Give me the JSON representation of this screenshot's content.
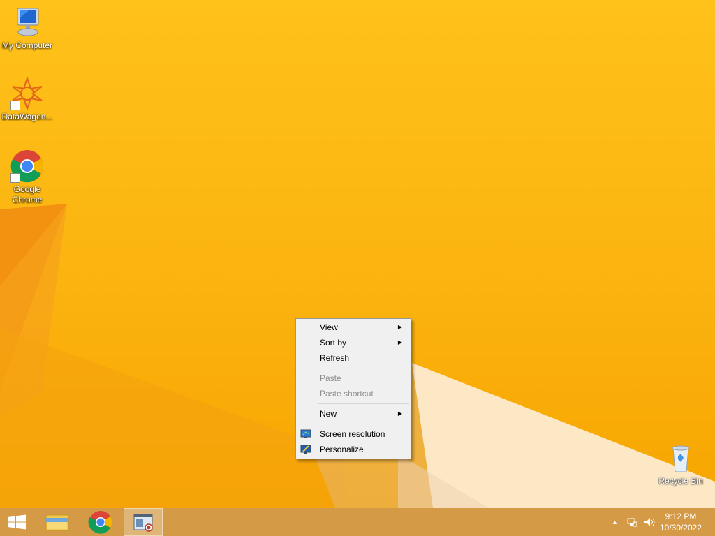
{
  "desktop": {
    "icons": [
      {
        "label": "My Computer"
      },
      {
        "label": "DataWagon..."
      },
      {
        "label": "Google Chrome"
      },
      {
        "label": "Recycle Bin"
      }
    ]
  },
  "context_menu": {
    "items": [
      {
        "label": "View",
        "has_submenu": true,
        "enabled": true
      },
      {
        "label": "Sort by",
        "has_submenu": true,
        "enabled": true
      },
      {
        "label": "Refresh",
        "has_submenu": false,
        "enabled": true
      },
      {
        "label": "Paste",
        "has_submenu": false,
        "enabled": false
      },
      {
        "label": "Paste shortcut",
        "has_submenu": false,
        "enabled": false
      },
      {
        "label": "New",
        "has_submenu": true,
        "enabled": true
      },
      {
        "label": "Screen resolution",
        "icon": "monitor-icon",
        "enabled": true
      },
      {
        "label": "Personalize",
        "icon": "personalize-icon",
        "enabled": true
      }
    ],
    "submenu_glyph": "▶"
  },
  "taskbar": {
    "buttons": [
      {
        "name": "start",
        "icon": "windows-logo-icon"
      },
      {
        "name": "file-explorer",
        "icon": "folder-icon"
      },
      {
        "name": "chrome",
        "icon": "chrome-icon"
      },
      {
        "name": "active-app",
        "icon": "app-window-icon"
      }
    ],
    "tray": {
      "show_hidden_glyph": "▲",
      "clock_time": "9:12 PM",
      "clock_date": "10/30/2022"
    }
  },
  "colors": {
    "wallpaper": "#fbb20e",
    "taskbar": "#d59a45",
    "menu_bg": "#f0f0f0"
  }
}
